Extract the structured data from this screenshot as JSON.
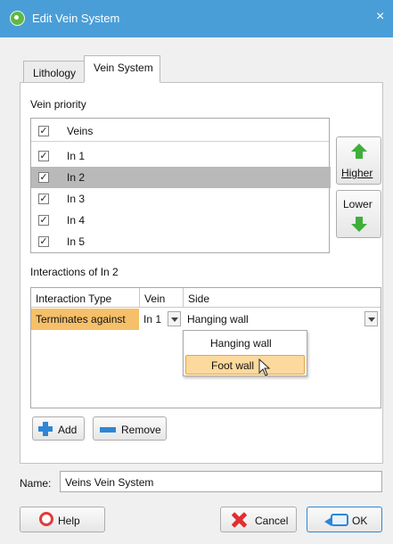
{
  "window": {
    "title": "Edit Vein System",
    "close_glyph": "×"
  },
  "tabs": [
    {
      "label": "Lithology",
      "active": false
    },
    {
      "label": "Vein System",
      "active": true
    }
  ],
  "vein_priority": {
    "label": "Vein priority",
    "column_header": "Veins",
    "header_checked": true,
    "items": [
      {
        "label": "In 1",
        "checked": true,
        "selected": false
      },
      {
        "label": "In 2",
        "checked": true,
        "selected": true
      },
      {
        "label": "In 3",
        "checked": true,
        "selected": false
      },
      {
        "label": "In 4",
        "checked": true,
        "selected": false
      },
      {
        "label": "In 5",
        "checked": true,
        "selected": false
      }
    ],
    "higher_label": "Higher",
    "lower_label": "Lower"
  },
  "interactions": {
    "label": "Interactions of In 2",
    "headers": {
      "type": "Interaction Type",
      "vein": "Vein",
      "side": "Side"
    },
    "row": {
      "type": "Terminates against",
      "vein": "In 1",
      "side": "Hanging wall"
    },
    "side_options": [
      "Hanging wall",
      "Foot wall"
    ],
    "highlighted_option": "Foot wall",
    "add_label": "Add",
    "remove_label": "Remove"
  },
  "name_field": {
    "label": "Name:",
    "value": "Veins Vein System"
  },
  "footer": {
    "help_label": "Help",
    "cancel_label": "Cancel",
    "ok_label": "OK"
  },
  "icons": {
    "app": "app-icon",
    "higher": "arrow-up-icon",
    "lower": "arrow-down-icon",
    "add": "plus-icon",
    "remove": "minus-icon",
    "help": "lifebuoy-icon",
    "cancel": "cross-icon",
    "ok": "ok-arrow-icon",
    "cursor": "mouse-pointer-icon"
  },
  "colors": {
    "titlebar": "#4a9ed8",
    "selected_row": "#b9b9b9",
    "interaction_cell": "#f6c06a",
    "arrow": "#3fae3a",
    "accent": "#2f86d4",
    "cancel": "#e02f2f"
  }
}
